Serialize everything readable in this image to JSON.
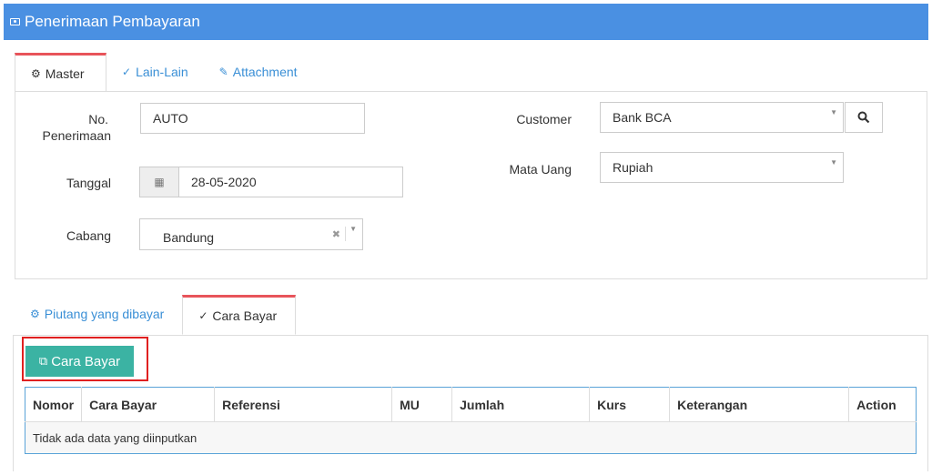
{
  "header": {
    "title": "Penerimaan Pembayaran",
    "icon": "money-icon"
  },
  "top_tabs": [
    {
      "label": "Master",
      "icon": "cogs-icon",
      "active": true
    },
    {
      "label": "Lain-Lain",
      "icon": "check-circle-icon",
      "active": false
    },
    {
      "label": "Attachment",
      "icon": "paperclip-icon",
      "active": false
    }
  ],
  "form": {
    "no_penerimaan": {
      "label_line1": "No.",
      "label_line2": "Penerimaan",
      "value": "AUTO"
    },
    "tanggal": {
      "label": "Tanggal",
      "value": "28-05-2020"
    },
    "cabang": {
      "label": "Cabang",
      "value": "Bandung"
    },
    "customer": {
      "label": "Customer",
      "value": "Bank BCA"
    },
    "mata_uang": {
      "label": "Mata Uang",
      "value": "Rupiah"
    }
  },
  "bottom_tabs": [
    {
      "label": "Piutang yang dibayar",
      "icon": "cogs-icon",
      "active": false
    },
    {
      "label": "Cara Bayar",
      "icon": "check-circle-icon",
      "active": true
    }
  ],
  "cara_bayar_button": {
    "label": "Cara Bayar",
    "icon": "copy-icon",
    "color": "#3bb3a3"
  },
  "table": {
    "columns": [
      "Nomor",
      "Cara Bayar",
      "Referensi",
      "MU",
      "Jumlah",
      "Kurs",
      "Keterangan",
      "Action"
    ],
    "empty_message": "Tidak ada data yang diinputkan"
  },
  "colors": {
    "header_bg": "#4a90e2",
    "active_tab_accent": "#e8545a",
    "highlight": "#e02020"
  }
}
